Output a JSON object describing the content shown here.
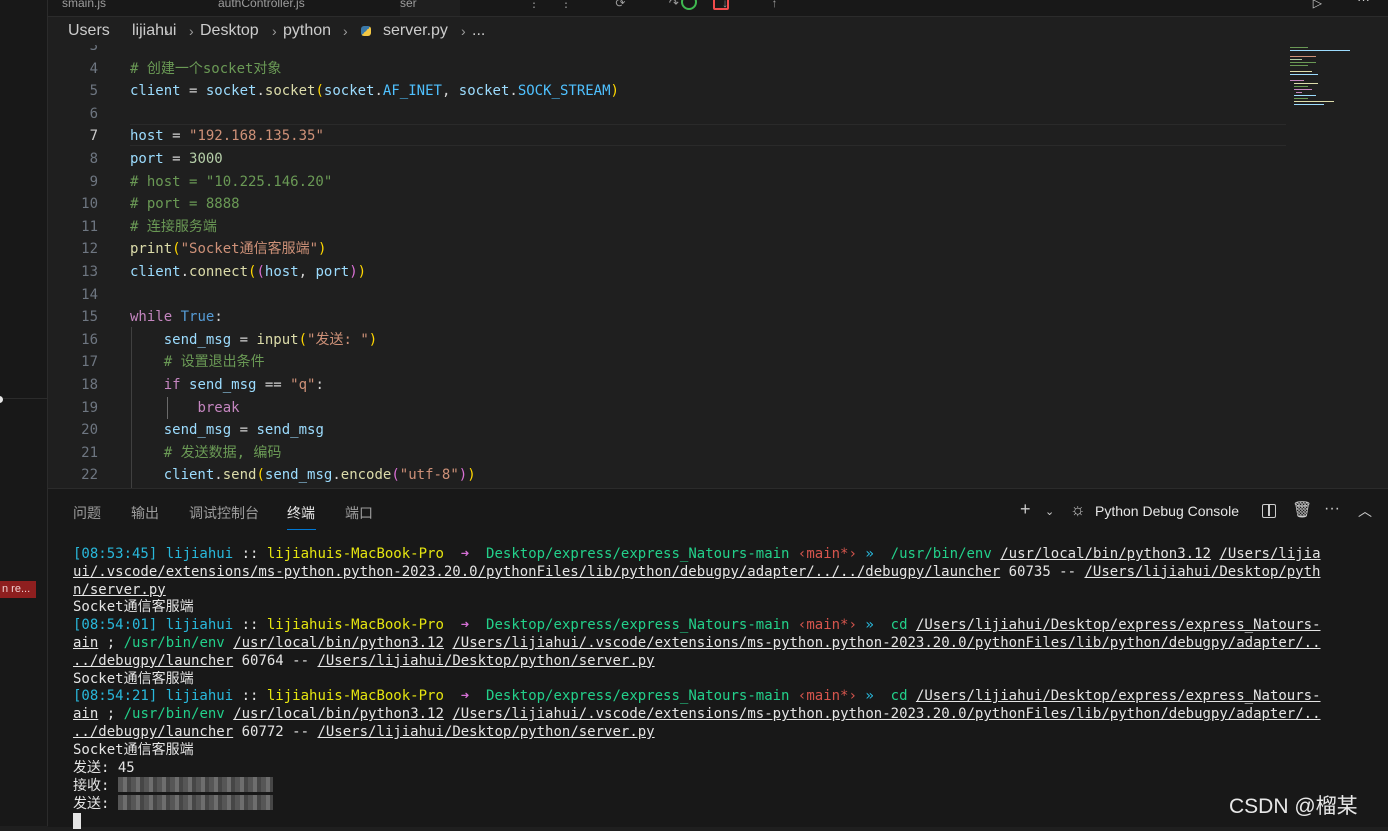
{
  "tabs": [
    {
      "label": "smain.js"
    },
    {
      "label": "authController.js"
    },
    {
      "label": "ser"
    }
  ],
  "breadcrumb": [
    "Users",
    "lijiahui",
    "Desktop",
    "python",
    "server.py",
    "..."
  ],
  "editor": {
    "active_line": 7,
    "lines": [
      {
        "n": 3,
        "tokens": []
      },
      {
        "n": 4,
        "tokens": [
          {
            "t": "# 创建一个socket对象",
            "c": "cm"
          }
        ]
      },
      {
        "n": 5,
        "tokens": [
          {
            "t": "client",
            "c": "var"
          },
          {
            "t": " = ",
            "c": "op"
          },
          {
            "t": "socket",
            "c": "var"
          },
          {
            "t": ".",
            "c": "op"
          },
          {
            "t": "socket",
            "c": "fn"
          },
          {
            "t": "(",
            "c": "p1"
          },
          {
            "t": "socket",
            "c": "var"
          },
          {
            "t": ".",
            "c": "op"
          },
          {
            "t": "AF_INET",
            "c": "const"
          },
          {
            "t": ", ",
            "c": "op"
          },
          {
            "t": "socket",
            "c": "var"
          },
          {
            "t": ".",
            "c": "op"
          },
          {
            "t": "SOCK_STREAM",
            "c": "const"
          },
          {
            "t": ")",
            "c": "p1"
          }
        ]
      },
      {
        "n": 6,
        "tokens": []
      },
      {
        "n": 7,
        "tokens": [
          {
            "t": "host",
            "c": "var"
          },
          {
            "t": " = ",
            "c": "op"
          },
          {
            "t": "\"192.168.135.35\"",
            "c": "str"
          }
        ]
      },
      {
        "n": 8,
        "tokens": [
          {
            "t": "port",
            "c": "var"
          },
          {
            "t": " = ",
            "c": "op"
          },
          {
            "t": "3000",
            "c": "num"
          }
        ]
      },
      {
        "n": 9,
        "tokens": [
          {
            "t": "# host = \"10.225.146.20\"",
            "c": "cm"
          }
        ]
      },
      {
        "n": 10,
        "tokens": [
          {
            "t": "# port = 8888",
            "c": "cm"
          }
        ]
      },
      {
        "n": 11,
        "tokens": [
          {
            "t": "# 连接服务端",
            "c": "cm"
          }
        ]
      },
      {
        "n": 12,
        "tokens": [
          {
            "t": "print",
            "c": "fn"
          },
          {
            "t": "(",
            "c": "p1"
          },
          {
            "t": "\"Socket通信客服端\"",
            "c": "str"
          },
          {
            "t": ")",
            "c": "p1"
          }
        ]
      },
      {
        "n": 13,
        "tokens": [
          {
            "t": "client",
            "c": "var"
          },
          {
            "t": ".",
            "c": "op"
          },
          {
            "t": "connect",
            "c": "fn"
          },
          {
            "t": "(",
            "c": "p1"
          },
          {
            "t": "(",
            "c": "p2"
          },
          {
            "t": "host",
            "c": "var"
          },
          {
            "t": ", ",
            "c": "op"
          },
          {
            "t": "port",
            "c": "var"
          },
          {
            "t": ")",
            "c": "p2"
          },
          {
            "t": ")",
            "c": "p1"
          }
        ]
      },
      {
        "n": 14,
        "tokens": []
      },
      {
        "n": 15,
        "tokens": [
          {
            "t": "while",
            "c": "kw"
          },
          {
            "t": " ",
            "c": "op"
          },
          {
            "t": "True",
            "c": "kw2"
          },
          {
            "t": ":",
            "c": "op"
          }
        ]
      },
      {
        "n": 16,
        "tokens": [
          {
            "t": "    ",
            "c": "op"
          },
          {
            "t": "send_msg",
            "c": "var"
          },
          {
            "t": " = ",
            "c": "op"
          },
          {
            "t": "input",
            "c": "fn"
          },
          {
            "t": "(",
            "c": "p1"
          },
          {
            "t": "\"发送: \"",
            "c": "str"
          },
          {
            "t": ")",
            "c": "p1"
          }
        ]
      },
      {
        "n": 17,
        "tokens": [
          {
            "t": "    ",
            "c": "op"
          },
          {
            "t": "# 设置退出条件",
            "c": "cm"
          }
        ]
      },
      {
        "n": 18,
        "tokens": [
          {
            "t": "    ",
            "c": "op"
          },
          {
            "t": "if",
            "c": "kw"
          },
          {
            "t": " ",
            "c": "op"
          },
          {
            "t": "send_msg",
            "c": "var"
          },
          {
            "t": " == ",
            "c": "op"
          },
          {
            "t": "\"q\"",
            "c": "str"
          },
          {
            "t": ":",
            "c": "op"
          }
        ]
      },
      {
        "n": 19,
        "tokens": [
          {
            "t": "        ",
            "c": "op"
          },
          {
            "t": "break",
            "c": "kw"
          }
        ]
      },
      {
        "n": 20,
        "tokens": [
          {
            "t": "    ",
            "c": "op"
          },
          {
            "t": "send_msg",
            "c": "var"
          },
          {
            "t": " = ",
            "c": "op"
          },
          {
            "t": "send_msg",
            "c": "var"
          }
        ]
      },
      {
        "n": 21,
        "tokens": [
          {
            "t": "    ",
            "c": "op"
          },
          {
            "t": "# 发送数据, 编码",
            "c": "cm"
          }
        ]
      },
      {
        "n": 22,
        "tokens": [
          {
            "t": "    ",
            "c": "op"
          },
          {
            "t": "client",
            "c": "var"
          },
          {
            "t": ".",
            "c": "op"
          },
          {
            "t": "send",
            "c": "fn"
          },
          {
            "t": "(",
            "c": "p1"
          },
          {
            "t": "send_msg",
            "c": "var"
          },
          {
            "t": ".",
            "c": "op"
          },
          {
            "t": "encode",
            "c": "fn"
          },
          {
            "t": "(",
            "c": "p2"
          },
          {
            "t": "\"utf-8\"",
            "c": "str"
          },
          {
            "t": ")",
            "c": "p2"
          },
          {
            "t": ")",
            "c": "p1"
          }
        ]
      }
    ]
  },
  "panel": {
    "tabs": [
      "问题",
      "输出",
      "调试控制台",
      "终端",
      "端口"
    ],
    "active_tab": "终端",
    "debug_console_label": "Python Debug Console",
    "terminal_lines": [
      [
        {
          "t": "[08:53:45] ",
          "c": "cy"
        },
        {
          "t": "lijiahui",
          "c": "cy"
        },
        {
          "t": " :: ",
          "c": "w"
        },
        {
          "t": "lijiahuis-MacBook-Pro",
          "c": "ye"
        },
        {
          "t": "  ➜  ",
          "c": "mg"
        },
        {
          "t": "Desktop/express/express_Natours-main",
          "c": "gr"
        },
        {
          "t": " ‹main*›",
          "c": "rd"
        },
        {
          "t": " »  ",
          "c": "cy"
        },
        {
          "t": "/usr/bin/env",
          "c": "gr"
        },
        {
          "t": " ",
          "c": "w"
        },
        {
          "t": "/usr/local/bin/python3.12",
          "c": "ul"
        },
        {
          "t": " ",
          "c": "w"
        },
        {
          "t": "/Users/lijia",
          "c": "ul"
        }
      ],
      [
        {
          "t": "ui/.vscode/extensions/ms-python.python-2023.20.0/pythonFiles/lib/python/debugpy/adapter/../../debugpy/launcher",
          "c": "ul"
        },
        {
          "t": " 60735 -- ",
          "c": "w"
        },
        {
          "t": "/Users/lijiahui/Desktop/pyth",
          "c": "ul"
        }
      ],
      [
        {
          "t": "n/server.py",
          "c": "ul"
        }
      ],
      [
        {
          "t": "Socket通信客服端",
          "c": "w"
        }
      ],
      [
        {
          "t": "[08:54:01] ",
          "c": "cy"
        },
        {
          "t": "lijiahui",
          "c": "cy"
        },
        {
          "t": " :: ",
          "c": "w"
        },
        {
          "t": "lijiahuis-MacBook-Pro",
          "c": "ye"
        },
        {
          "t": "  ➜  ",
          "c": "mg"
        },
        {
          "t": "Desktop/express/express_Natours-main",
          "c": "gr"
        },
        {
          "t": " ‹main*›",
          "c": "rd"
        },
        {
          "t": " »  ",
          "c": "cy"
        },
        {
          "t": "cd",
          "c": "gr"
        },
        {
          "t": " ",
          "c": "w"
        },
        {
          "t": "/Users/lijiahui/Desktop/express/express_Natours-",
          "c": "ul"
        }
      ],
      [
        {
          "t": "ain",
          "c": "ul"
        },
        {
          "t": " ; ",
          "c": "w"
        },
        {
          "t": "/usr/bin/env",
          "c": "gr"
        },
        {
          "t": " ",
          "c": "w"
        },
        {
          "t": "/usr/local/bin/python3.12",
          "c": "ul"
        },
        {
          "t": " ",
          "c": "w"
        },
        {
          "t": "/Users/lijiahui/.vscode/extensions/ms-python.python-2023.20.0/pythonFiles/lib/python/debugpy/adapter/..",
          "c": "ul"
        }
      ],
      [
        {
          "t": "../debugpy/launcher",
          "c": "ul"
        },
        {
          "t": " 60764 -- ",
          "c": "w"
        },
        {
          "t": "/Users/lijiahui/Desktop/python/server.py",
          "c": "ul"
        }
      ],
      [
        {
          "t": "Socket通信客服端",
          "c": "w"
        }
      ],
      [
        {
          "t": "[08:54:21] ",
          "c": "cy"
        },
        {
          "t": "lijiahui",
          "c": "cy"
        },
        {
          "t": " :: ",
          "c": "w"
        },
        {
          "t": "lijiahuis-MacBook-Pro",
          "c": "ye"
        },
        {
          "t": "  ➜  ",
          "c": "mg"
        },
        {
          "t": "Desktop/express/express_Natours-main",
          "c": "gr"
        },
        {
          "t": " ‹main*›",
          "c": "rd"
        },
        {
          "t": " »  ",
          "c": "cy"
        },
        {
          "t": "cd",
          "c": "gr"
        },
        {
          "t": " ",
          "c": "w"
        },
        {
          "t": "/Users/lijiahui/Desktop/express/express_Natours-",
          "c": "ul"
        }
      ],
      [
        {
          "t": "ain",
          "c": "ul"
        },
        {
          "t": " ; ",
          "c": "w"
        },
        {
          "t": "/usr/bin/env",
          "c": "gr"
        },
        {
          "t": " ",
          "c": "w"
        },
        {
          "t": "/usr/local/bin/python3.12",
          "c": "ul"
        },
        {
          "t": " ",
          "c": "w"
        },
        {
          "t": "/Users/lijiahui/.vscode/extensions/ms-python.python-2023.20.0/pythonFiles/lib/python/debugpy/adapter/..",
          "c": "ul"
        }
      ],
      [
        {
          "t": "../debugpy/launcher",
          "c": "ul"
        },
        {
          "t": " 60772 -- ",
          "c": "w"
        },
        {
          "t": "/Users/lijiahui/Desktop/python/server.py",
          "c": "ul"
        }
      ],
      [
        {
          "t": "Socket通信客服端",
          "c": "w"
        }
      ],
      [
        {
          "t": "发送: 45",
          "c": "w"
        }
      ],
      [
        {
          "t": "接收: ",
          "c": "w"
        },
        {
          "t": "",
          "c": "blur"
        }
      ],
      [
        {
          "t": "发送: ",
          "c": "w"
        },
        {
          "t": "",
          "c": "blur"
        }
      ],
      [
        {
          "t": "",
          "c": "cursor"
        }
      ]
    ]
  },
  "sidebar_tag": "n re...",
  "watermark": "CSDN @榴某",
  "colors": {
    "editor_bg": "#1f1f1f",
    "panel_bg": "#181818",
    "accent": "#0078d4",
    "comment": "#6a9955",
    "string": "#ce9178",
    "keyword": "#c586c0"
  }
}
